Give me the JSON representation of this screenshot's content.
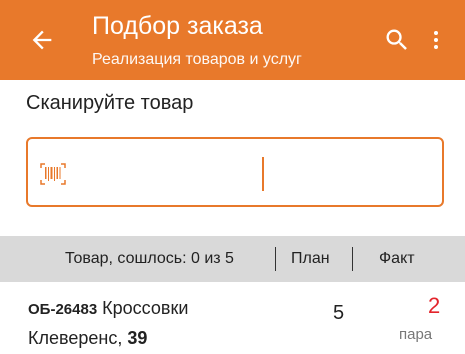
{
  "appbar": {
    "title": "Подбор заказа",
    "subtitle": "Реализация товаров и услуг",
    "icons": [
      "arrow-back-icon",
      "search-icon",
      "more-vert-icon"
    ],
    "color": "#e8792b"
  },
  "scan": {
    "prompt": "Сканируйте товар",
    "input_value": "",
    "accent": "#e8792b"
  },
  "table": {
    "header": {
      "goods": "Товар, сошлось: 0 из 5",
      "plan": "План",
      "fact": "Факт"
    },
    "rows": [
      {
        "code": "ОБ-26483",
        "name": "Кроссовки Клеверенс,",
        "size": "39",
        "plan": "5",
        "fact": "2",
        "unit": "пара",
        "fact_color": "#e3242b"
      }
    ]
  }
}
